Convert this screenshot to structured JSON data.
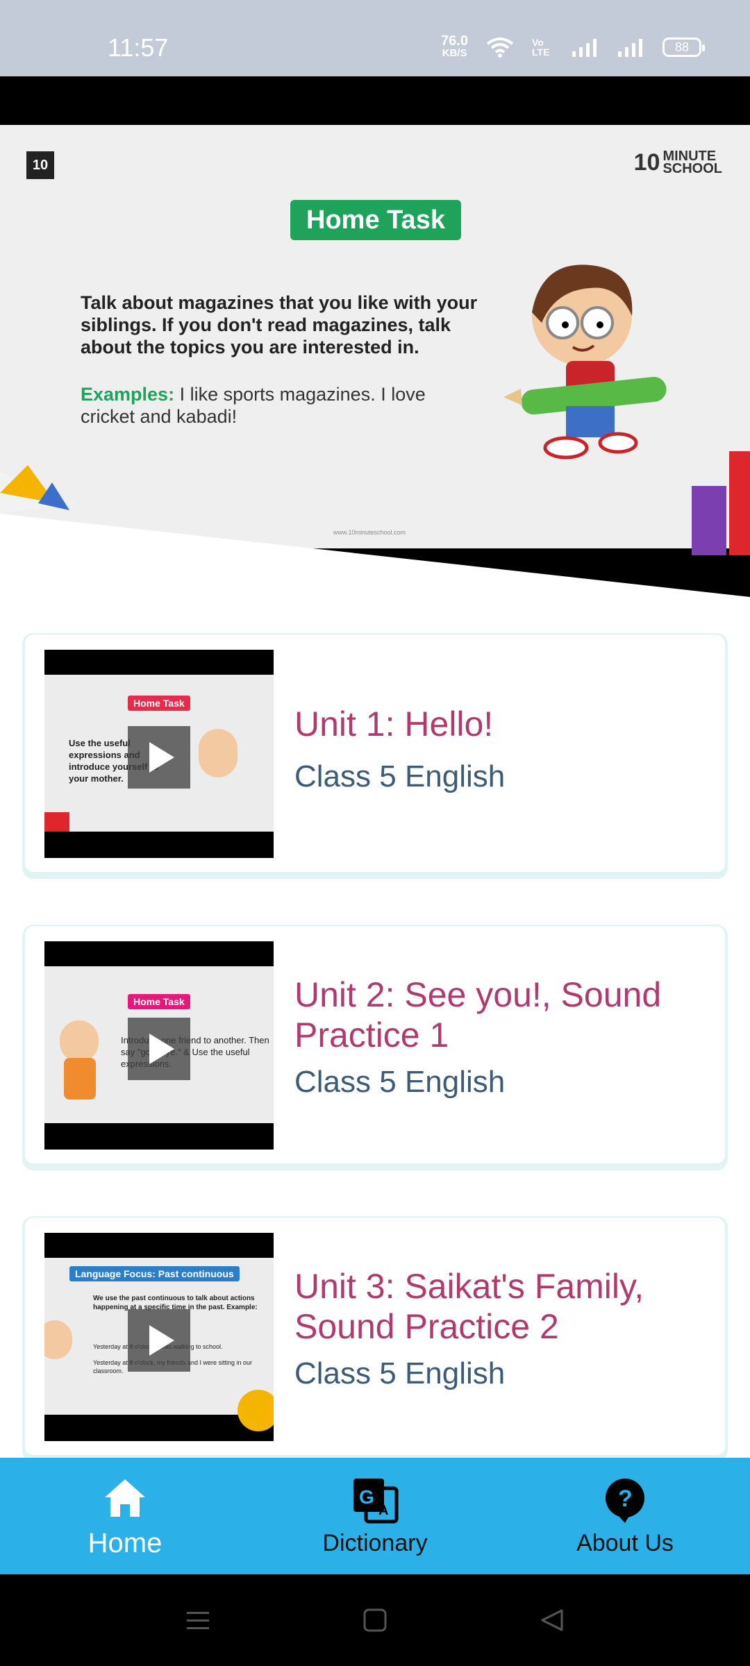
{
  "status_bar": {
    "time": "11:57",
    "net_speed_value": "76.0",
    "net_speed_unit": "KB/S",
    "volte": "Vo LTE",
    "battery": "88"
  },
  "banner": {
    "logo_left": "10",
    "logo_right_num": "10",
    "logo_right_text_1": "MINUTE",
    "logo_right_text_2": "SCHOOL",
    "pill": "Home Task",
    "body": "Talk about magazines that you like with your siblings. If you don't read magazines, talk about the topics you are interested in.",
    "example_label": "Examples:",
    "example_text": " I like sports magazines. I love cricket and kabadi!",
    "url": "www.10minuteschool.com"
  },
  "cards": [
    {
      "title": "Unit 1: Hello!",
      "subtitle": "Class 5 English",
      "thumb_pill": "Home Task",
      "thumb_text": "Use the useful expressions and introduce yourself to your mother."
    },
    {
      "title": "Unit 2: See you!, Sound Practice 1",
      "subtitle": "Class 5 English",
      "thumb_pill": "Home Task",
      "thumb_text": "Introduce one friend to another. Then say \"goodbye.\" & Use the useful expressions."
    },
    {
      "title": "Unit 3: Saikat's Family, Sound Practice 2",
      "subtitle": "Class 5 English",
      "thumb_pill": "Language Focus: Past continuous",
      "thumb_text": "We use the past continuous to talk about actions happening at a specific time in the past. Example:",
      "thumb_bullet_1": "Yesterday at 8 o'clock, I was walking to school.",
      "thumb_bullet_2": "Yesterday at 8 o'clock, my friends and I were sitting in our classroom."
    }
  ],
  "bottom_nav": {
    "home": "Home",
    "dictionary": "Dictionary",
    "about": "About Us"
  },
  "colors": {
    "nav_bg": "#2bb0e8",
    "title": "#b03a6e",
    "subtitle": "#3d5a76",
    "pill_green": "#1fa35a"
  }
}
